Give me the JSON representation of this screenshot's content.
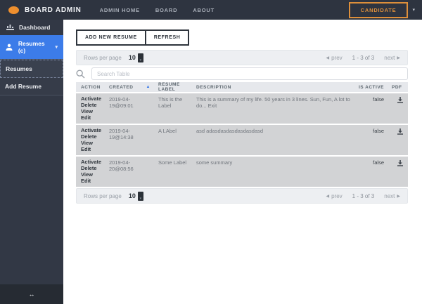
{
  "navbar": {
    "brand": "BOARD ADMIN",
    "items": [
      {
        "label": "ADMIN HOME"
      },
      {
        "label": "BOARD"
      },
      {
        "label": "ABOUT"
      }
    ],
    "user_button": "CANDIDATE",
    "caret": "▾"
  },
  "sidebar": {
    "dashboard_label": "Dashboard",
    "resumes_label": "Resumes (c)",
    "resumes_chevron": "▾",
    "subitems": [
      {
        "label": "Resumes"
      },
      {
        "label": "Add Resume"
      }
    ],
    "collapse_toggle": "↔"
  },
  "toolbar": {
    "add_label": "ADD NEW RESUME",
    "refresh_label": "REFRESH"
  },
  "pagination": {
    "rows_per_page_label": "Rows per page",
    "rows_per_page_value": "10",
    "prev_arrow": "◀",
    "prev_label": "prev",
    "range_label": "1 - 3 of 3",
    "next_label": "next",
    "next_arrow": "▶"
  },
  "search": {
    "placeholder": "Search Table"
  },
  "table": {
    "columns": [
      "ACTION",
      "CREATED",
      "RESUME LABEL",
      "DESCRIPTION",
      "IS ACTIVE",
      "PDF"
    ],
    "sort_column": "CREATED",
    "sort_arrow": "▲",
    "action_links": [
      "Activate",
      "Delete",
      "View",
      "Edit"
    ],
    "rows": [
      {
        "created": "2019-04-19@09:01",
        "label": "This is the Label",
        "description": "This is a summary of my life. 50 years in 3 lines. Sun, Fun, A lot to do... Exit",
        "is_active": "false"
      },
      {
        "created": "2019-04-19@14:38",
        "label": "A LAbel",
        "description": "asd adasdasdasdasdasdasd",
        "is_active": "false"
      },
      {
        "created": "2019-04-20@08:56",
        "label": "Some Label",
        "description": "some summary",
        "is_active": "false"
      }
    ]
  },
  "colors": {
    "navbar_bg": "#2e3440",
    "sidebar_bg": "#323845",
    "active_blue": "#3c7ce9",
    "accent_orange": "#dd8f3b",
    "row_gray": "#d2d3d5",
    "bar_gray": "#edeff2"
  }
}
